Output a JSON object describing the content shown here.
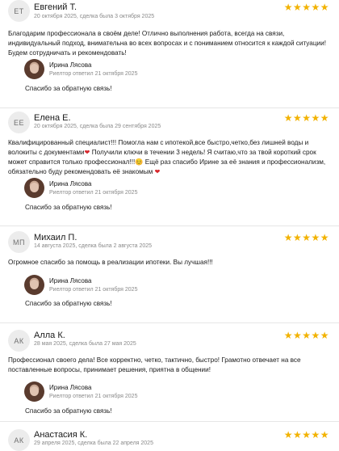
{
  "reviews": [
    {
      "initials": "ЕТ",
      "name": "Евгений Т.",
      "meta": "20 октября 2025, сделка была 3 октября 2025",
      "stars": "★★★★★",
      "text_lines": [
        "Благодарим профессионала в своём деле! Отлично выполнения работа, всегда на связи,",
        "индивидуальный подход, внимательна во всех вопросах и с пониманием относится к каждой ситуации!",
        "Будем сотрудничать и рекомендовать!"
      ],
      "reply_name": "Ирина Лясова",
      "reply_meta": "Риелтор ответил 21 октября 2025",
      "reply_text": "Спасибо за обратную связь!"
    },
    {
      "initials": "ЕЕ",
      "name": "Елена Е.",
      "meta": "20 октября 2025, сделка была 29 сентября 2025",
      "stars": "★★★★★",
      "text_lines": [
        "Квалифицированный специалист!!! Помогла нам с ипотекой,все быстро,четко,без лишней воды и",
        "волокиты с документами",
        " Получили ключи в течении 3 недель! Я считаю,что за твой короткий срок",
        "может справится только профессионал!!!",
        " Ещё раз спасибо Ирине за её знания и профессионализм,",
        "обязательно буду рекомендовать её знакомым"
      ],
      "emoji_heart": "❤",
      "emoji_smile": "😊",
      "reply_name": "Ирина Лясова",
      "reply_meta": "Риелтор ответил 21 октября 2025",
      "reply_text": "Спасибо за обратную связь!"
    },
    {
      "initials": "МП",
      "name": "Михаил П.",
      "meta": "14 августа 2025, сделка была 2 августа 2025",
      "stars": "★★★★★",
      "text_lines": [
        "Огромное спасибо за помощь в реализации ипотеки. Вы лучшая!!!"
      ],
      "reply_name": "Ирина Лясова",
      "reply_meta": "Риелтор ответил 21 октября 2025",
      "reply_text": "Спасибо за обратную связь!"
    },
    {
      "initials": "АК",
      "name": "Алла К.",
      "meta": "28 мая 2025, сделка была 27 мая 2025",
      "stars": "★★★★★",
      "text_lines": [
        "Профессионал своего дела! Все корректно, четко, тактично, быстро! Грамотно отвечает на все",
        "поставленные вопросы, принимает решения, приятна в общении!"
      ],
      "reply_name": "Ирина Лясова",
      "reply_meta": "Риелтор ответил 21 октября 2025",
      "reply_text": "Спасибо за обратную связь!"
    },
    {
      "initials": "АК",
      "name": "Анастасия К.",
      "meta": "29 апреля 2025, сделка была 22 апреля 2025",
      "stars": "★★★★★"
    }
  ],
  "colors": {
    "star": "#f2b200",
    "avatar_bg": "#ececec",
    "divider": "#e6e6e6",
    "heart": "#d7262b"
  }
}
